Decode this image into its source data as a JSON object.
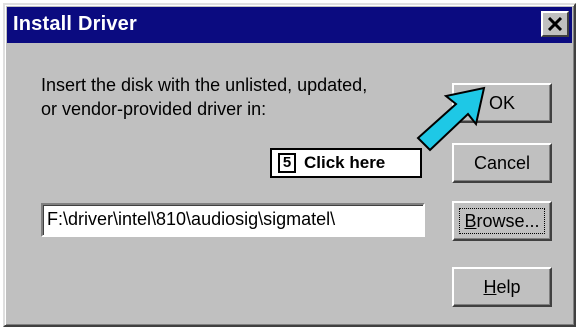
{
  "window": {
    "title": "Install Driver",
    "close_icon": "close-icon"
  },
  "prompt": {
    "line1": "Insert the disk with the unlisted, updated,",
    "line2": "or vendor-provided driver in:"
  },
  "path_field": {
    "value": "F:\\driver\\intel\\810\\audiosig\\sigmatel\\"
  },
  "buttons": {
    "ok": "OK",
    "cancel": "Cancel",
    "browse_underlined": "B",
    "browse_rest": "rowse...",
    "help_underlined": "H",
    "help_rest": "elp"
  },
  "callout": {
    "step_number": "5",
    "text": "Click here",
    "arrow_color": "#1ec8e6"
  },
  "colors": {
    "titlebar": "#0b0b80",
    "dialog_face": "#c0c0c0",
    "field_bg": "#ffffff"
  }
}
